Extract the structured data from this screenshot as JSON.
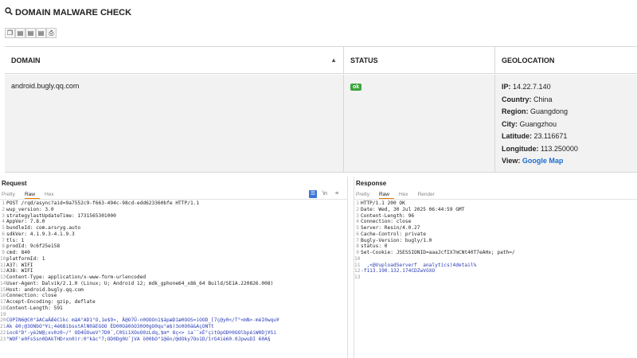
{
  "header": {
    "title": "DOMAIN MALWARE CHECK",
    "title_icon": "magnifier-icon"
  },
  "toolbar": {
    "buttons": [
      "copy-icon",
      "csv-icon",
      "excel-icon",
      "pdf-icon",
      "print-icon"
    ]
  },
  "table": {
    "columns": [
      "DOMAIN",
      "STATUS",
      "GEOLOCATION"
    ],
    "row": {
      "domain": "android.bugly.qq.com",
      "status": "ok",
      "geo": [
        {
          "label": "IP:",
          "value": "14.22.7.140"
        },
        {
          "label": "Country:",
          "value": "China"
        },
        {
          "label": "Region:",
          "value": "Guangdong"
        },
        {
          "label": "City:",
          "value": "Guangzhou"
        },
        {
          "label": "Latitude:",
          "value": "23.116671"
        },
        {
          "label": "Longitude:",
          "value": "113.250000"
        },
        {
          "label": "View:",
          "value": "Google Map"
        }
      ]
    }
  },
  "request": {
    "title": "Request",
    "tabs": [
      "Pretty",
      "Raw",
      "Hex"
    ],
    "active_tab": "Raw",
    "tools": [
      "\\n",
      "≡"
    ],
    "lines": [
      "POST /rqd/async?aid=9a7552c9-f663-494c-98cd-edd623360bfe HTTP/1.1",
      "wup_version: 3.0",
      "strategylastUpdateTime: 1731565301000",
      "AppVer: 7.8.0",
      "bundleId: com.arsryg.auto",
      "sdkVer: 4.1.9.3-4.1.9.3",
      "tls: 1",
      "prodId: 9c6f25e158",
      "cmd: 840",
      "platformId: 1",
      "A37: WIFI",
      "A38: WIFI",
      "Content-Type: application/x-www-form-urlencoded",
      "User-Agent: Dalvik/2.1.0 (Linux; U; Android 12; mdk_gphone64_x86_64 Build/SE1A.220826.008)",
      "Host: android.bugly.qq.com",
      "Connection: close",
      "Accept-Encoding: gzip, deflate",
      "Content-Length: 591",
      "",
      "COPIN6@C0°äACaÄÆéCìkc mäA°AD1°O,1e$9», Ä@O7Ü-n0OOOn1$ápæD1æ0OOS=iOOD_[7ç@y0</T°<mN>-méI0wqu¥",
      "Ak ë0;@3ONbO°¥i;4é6BibsstAlN0äEGOO ÈD00Oä0ôO30O0gO0qu°æ$)3o0O0ä&AçONTt",
      "ioc6°D°-yè2W@;xv0z0~/° OD4ÜOueV°7D0´,C0Si1XOoO0zLdq,$m* 8ç<> ia¯¯xÈ°çitOpOD®0OOlbpéiW0Dj¥Si",
      "°WOF'e0FsSsn0DAkTHDrxn0)r:0°kàc°7;OD0Dg0U¯jVA ö00bO°1@ên/@dOky7Oo1D/îrG4iè60.0JpwuDI 60A§"
    ]
  },
  "response": {
    "title": "Response",
    "tabs": [
      "Pretty",
      "Raw",
      "Hex",
      "Render"
    ],
    "active_tab": "Raw",
    "lines": [
      "HTTP/1.1 200 OK",
      "Date: Wed, 30 Jul 2025 06:44:59 GMT",
      "Content-Length: 96",
      "Connection: close",
      "Server: Resin/4.0.27",
      "Cache-Control: private",
      "Bugly-Version: bugly/1.0",
      "status: 0",
      "Set-Cookie: JSESSIONID=aaaJcfIX7mCNt40T7eAHx; path=/",
      "",
      "  ,<@VuploadServerf  analytics)4detail%",
      "-f113.190.132.174CDZwVöXO",
      ""
    ]
  }
}
